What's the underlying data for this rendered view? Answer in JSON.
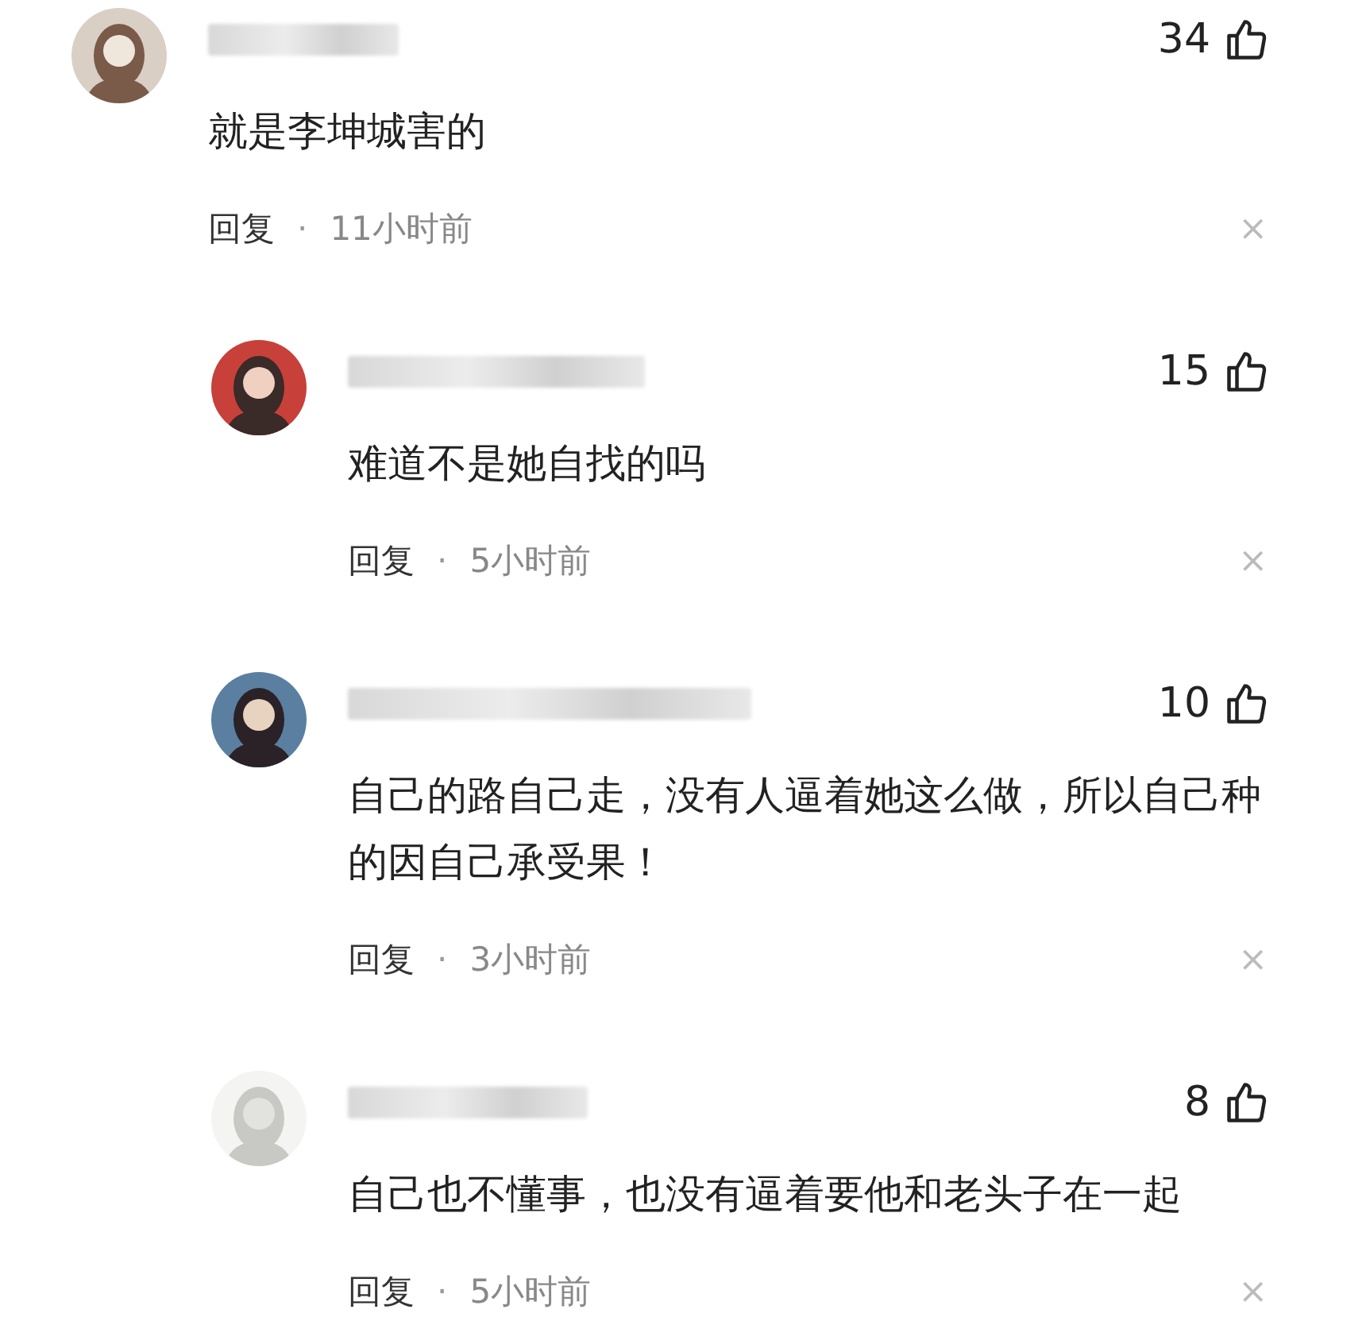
{
  "comments": [
    {
      "kind": "top",
      "likes": "34",
      "text": "就是李坤城害的",
      "reply": "回复",
      "separator": "·",
      "time": "11小时前",
      "close": "×"
    },
    {
      "kind": "reply",
      "likes": "15",
      "text": "难道不是她自找的吗",
      "reply": "回复",
      "separator": "·",
      "time": "5小时前",
      "close": "×"
    },
    {
      "kind": "reply",
      "likes": "10",
      "text": "自己的路自己走，没有人逼着她这么做，所以自己种的因自己承受果！",
      "reply": "回复",
      "separator": "·",
      "time": "3小时前",
      "close": "×"
    },
    {
      "kind": "reply",
      "likes": "8",
      "text": "自己也不懂事，也没有逼着要他和老头子在一起",
      "reply": "回复",
      "separator": "·",
      "time": "5小时前",
      "close": "×"
    }
  ]
}
